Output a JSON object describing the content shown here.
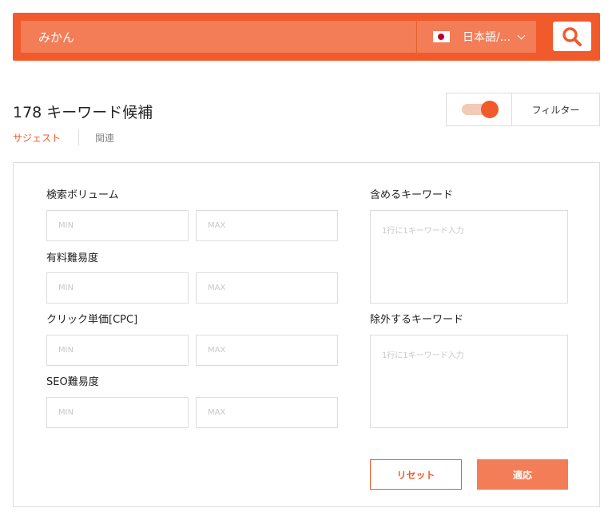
{
  "search": {
    "query": "みかん",
    "language_label": "日本語/..."
  },
  "results": {
    "count_title": "178 キーワード候補"
  },
  "filter": {
    "label": "フィルター",
    "toggle_on": true
  },
  "tabs": [
    {
      "label": "サジェスト",
      "active": true
    },
    {
      "label": "関連",
      "active": false
    }
  ],
  "panel": {
    "volume_label": "検索ボリューム",
    "difficulty_label": "有料難易度",
    "cpc_label": "クリック単価[CPC]",
    "seo_label": "SEO難易度",
    "min_placeholder": "MIN",
    "max_placeholder": "MAX",
    "include_label": "含めるキーワード",
    "exclude_label": "除外するキーワード",
    "keyword_placeholder": "1行に1キーワード入力",
    "reset_label": "リセット",
    "apply_label": "適応"
  },
  "colors": {
    "accent": "#f15a2b",
    "accent_light": "#f37d56"
  }
}
